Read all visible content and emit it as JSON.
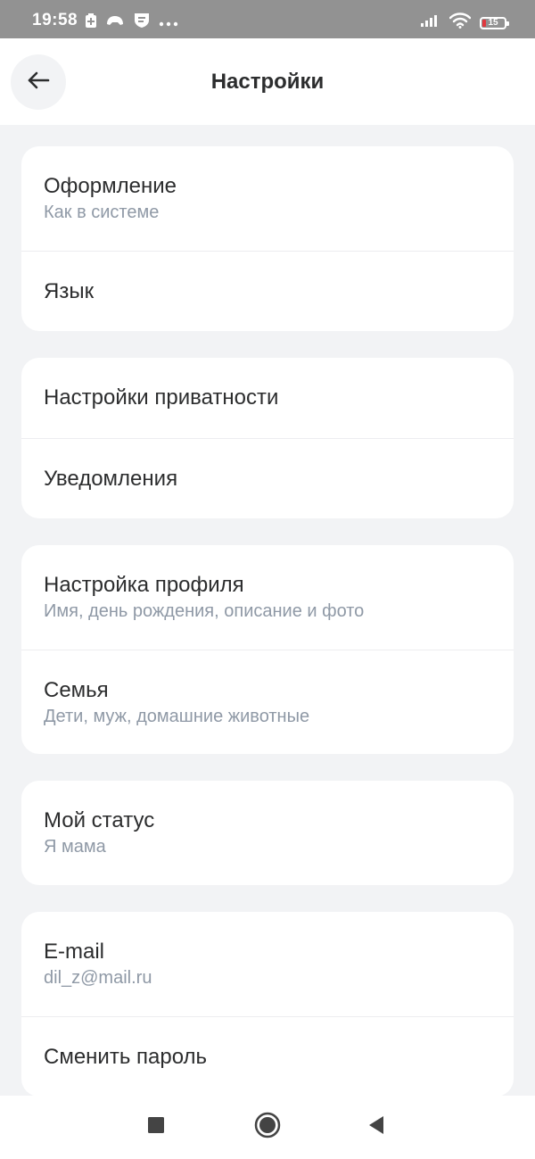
{
  "status_bar": {
    "time": "19:58",
    "battery_level": "15",
    "icons": [
      "battery-saver-icon",
      "game-icon",
      "shield-icon",
      "more-dots-icon",
      "signal-icon",
      "wifi-icon",
      "battery-icon"
    ]
  },
  "header": {
    "title": "Настройки",
    "back_icon": "arrow-left-icon"
  },
  "sections": [
    {
      "rows": [
        {
          "title": "Оформление",
          "subtitle": "Как в системе"
        },
        {
          "title": "Язык"
        }
      ]
    },
    {
      "rows": [
        {
          "title": "Настройки приватности"
        },
        {
          "title": "Уведомления"
        }
      ]
    },
    {
      "rows": [
        {
          "title": "Настройка профиля",
          "subtitle": "Имя, день рождения, описание и фото"
        },
        {
          "title": "Семья",
          "subtitle": "Дети, муж, домашние животные"
        }
      ]
    },
    {
      "rows": [
        {
          "title": "Мой статус",
          "subtitle": "Я мама"
        }
      ]
    },
    {
      "rows": [
        {
          "title": "E-mail",
          "subtitle": "dil_z@mail.ru"
        },
        {
          "title": "Сменить пароль"
        }
      ]
    }
  ],
  "nav_bar": {
    "icons": [
      "recents-square-icon",
      "home-circle-icon",
      "back-triangle-icon"
    ]
  },
  "colors": {
    "background": "#f2f3f5",
    "card": "#ffffff",
    "title_text": "#2c2d2e",
    "subtitle_text": "#8f99a6",
    "status_bar": "#929292",
    "battery_low": "#e0383e"
  }
}
